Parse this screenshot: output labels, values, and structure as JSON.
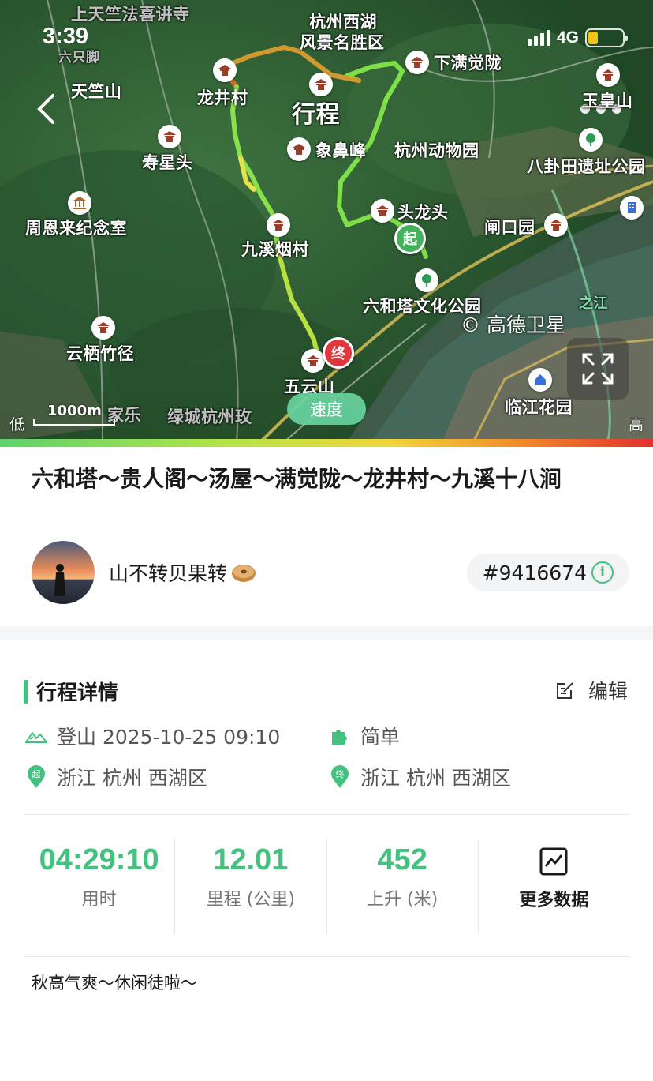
{
  "status_bar": {
    "time": "3:39",
    "network": "4G"
  },
  "map": {
    "labels": {
      "tianzhufa": "上天竺法喜讲寺",
      "west_lake": "杭州西湖",
      "west_lake_2": "风景名胜区",
      "tianzhushan": "天竺山",
      "longjingcun": "龙井村",
      "xiamanjue": "下满觉陇",
      "yuhuangshan": "玉皇山",
      "xingcheng": "行程",
      "xiangbifeng": "象鼻峰",
      "zoo": "杭州动物园",
      "bagua": "八卦田遗址公园",
      "shouxingtou": "寿星头",
      "zhouenlai": "周恩来纪念室",
      "toulongtou": "头龙头",
      "zhakouyuan": "闸口园",
      "jiuxi": "九溪烟村",
      "liuhe": "六和塔文化公园",
      "yunqi": "云栖竹径",
      "wuyunshan": "五云山",
      "lvcheng": "绿城杭州玫",
      "linjiang": "临江花园",
      "jiale": "家乐",
      "qianjiang": "之江",
      "liuzhi": "六只脚"
    },
    "marker_start": "起",
    "marker_end": "终",
    "copyright": "© 高德卫星",
    "speed_button": "速度",
    "scale": "1000m",
    "legend_low": "低",
    "legend_high": "高"
  },
  "trip": {
    "title": "六和塔～贵人阁～汤屋～满觉陇～龙井村～九溪十八涧",
    "author": "山不转贝果转",
    "id": "#9416674"
  },
  "details": {
    "section_title": "行程详情",
    "edit_label": "编辑",
    "type_date": "登山 2025-10-25 09:10",
    "difficulty": "简单",
    "start_location": "浙江 杭州 西湖区",
    "end_location": "浙江 杭州 西湖区"
  },
  "stats": [
    {
      "value": "04:29:10",
      "label": "用时"
    },
    {
      "value": "12.01",
      "label": "里程 (公里)"
    },
    {
      "value": "452",
      "label": "上升 (米)"
    }
  ],
  "more_data_label": "更多数据",
  "note": "秋高气爽～休闲徒啦～",
  "colors": {
    "accent": "#43c17e",
    "start_marker": "#43b25a",
    "end_marker": "#e0363c"
  }
}
